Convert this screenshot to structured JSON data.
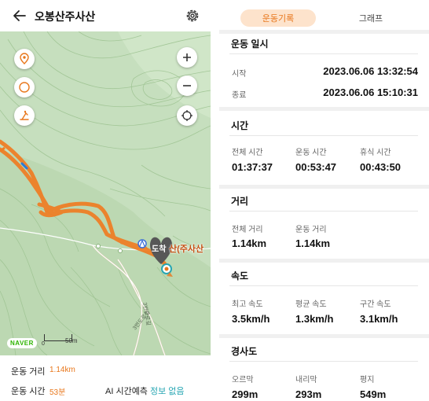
{
  "header": {
    "title": "오봉산주사산",
    "back_icon": "back-arrow-icon",
    "settings_icon": "gear-icon"
  },
  "map": {
    "place_label": "산(주사산",
    "arrival_label": "도착",
    "brand": "NAVER",
    "scale": "50m",
    "scale_zero": "0",
    "road_labels": [
      "3번도로길",
      "3번도로길"
    ],
    "route_color": "#f07c22"
  },
  "summary": {
    "distance_label": "운동 거리",
    "distance_value": "1.14km",
    "time_label": "운동 시간",
    "time_value": "53분",
    "ai_label": "AI 시간예측",
    "ai_value": "정보 없음"
  },
  "tabs": {
    "active": "운동기록",
    "other": "그래프"
  },
  "datetime": {
    "title": "운동 일시",
    "start_label": "시작",
    "start_value": "2023.06.06 13:32:54",
    "end_label": "종료",
    "end_value": "2023.06.06 15:10:31"
  },
  "time": {
    "title": "시간",
    "items": [
      {
        "label": "전체 시간",
        "value": "01:37:37"
      },
      {
        "label": "운동 시간",
        "value": "00:53:47"
      },
      {
        "label": "휴식 시간",
        "value": "00:43:50"
      }
    ]
  },
  "distance": {
    "title": "거리",
    "items": [
      {
        "label": "전체 거리",
        "value": "1.14km"
      },
      {
        "label": "운동 거리",
        "value": "1.14km"
      }
    ]
  },
  "speed": {
    "title": "속도",
    "items": [
      {
        "label": "최고 속도",
        "value": "3.5km/h"
      },
      {
        "label": "평균 속도",
        "value": "1.3km/h"
      },
      {
        "label": "구간 속도",
        "value": "3.1km/h"
      }
    ]
  },
  "slope": {
    "title": "경사도",
    "items": [
      {
        "label": "오르막",
        "value": "299m"
      },
      {
        "label": "내리막",
        "value": "293m"
      },
      {
        "label": "평지",
        "value": "549m"
      }
    ]
  },
  "colors": {
    "accent": "#e8771c",
    "accent_bg": "#fde3cc",
    "teal": "#27a6b3"
  }
}
